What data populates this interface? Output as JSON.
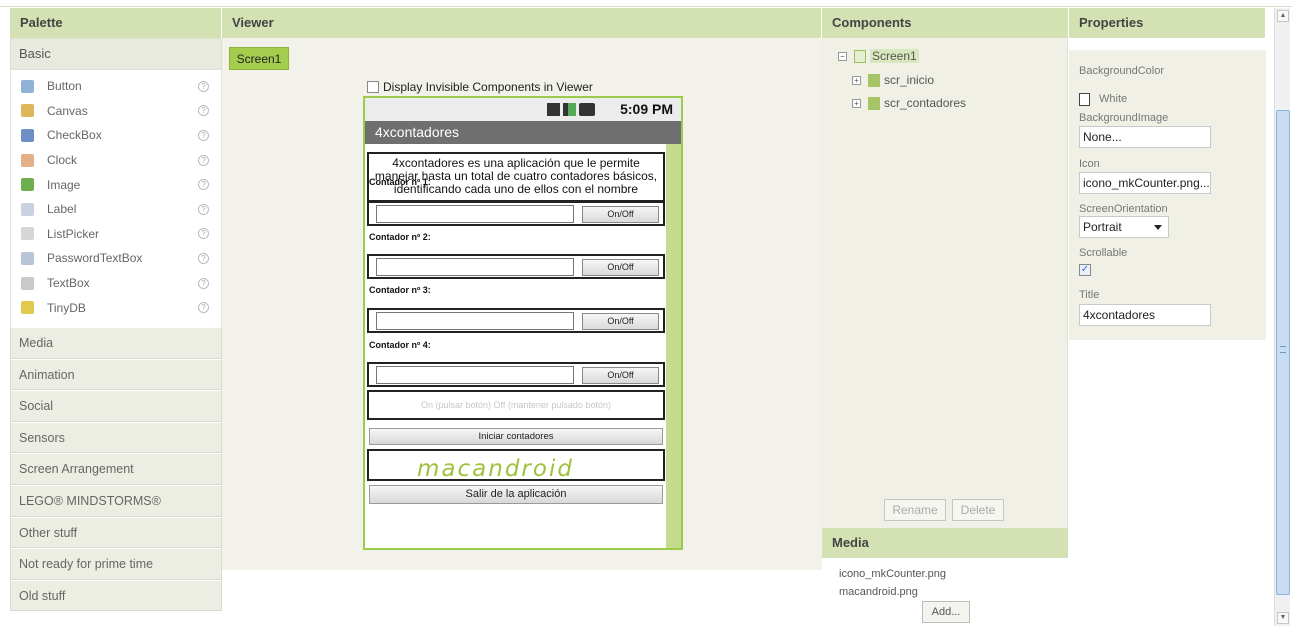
{
  "headers": {
    "palette": "Palette",
    "viewer": "Viewer",
    "components": "Components",
    "properties": "Properties",
    "media": "Media"
  },
  "palette": {
    "basic_label": "Basic",
    "items": [
      {
        "label": "Button",
        "icon": "button-icon",
        "color": "#8fb2d6"
      },
      {
        "label": "Canvas",
        "icon": "canvas-icon",
        "color": "#e0b65a"
      },
      {
        "label": "CheckBox",
        "icon": "checkbox-icon",
        "color": "#6d8fc4"
      },
      {
        "label": "Clock",
        "icon": "clock-icon",
        "color": "#e3b08a"
      },
      {
        "label": "Image",
        "icon": "image-icon",
        "color": "#6fae4f"
      },
      {
        "label": "Label",
        "icon": "label-icon",
        "color": "#c8d2e0"
      },
      {
        "label": "ListPicker",
        "icon": "listpicker-icon",
        "color": "#d6d6d6"
      },
      {
        "label": "PasswordTextBox",
        "icon": "password-icon",
        "color": "#b7c5d6"
      },
      {
        "label": "TextBox",
        "icon": "textbox-icon",
        "color": "#c9c9c9"
      },
      {
        "label": "TinyDB",
        "icon": "tinydb-icon",
        "color": "#e1c84f"
      }
    ],
    "help_glyph": "?",
    "categories": [
      "Media",
      "Animation",
      "Social",
      "Sensors",
      "Screen Arrangement",
      "LEGO® MINDSTORMS®",
      "Other stuff",
      "Not ready for prime time",
      "Old stuff"
    ]
  },
  "viewer": {
    "screen_tab": "Screen1",
    "display_invisible": "Display Invisible Components in Viewer",
    "status_time": "5:09 PM",
    "app_title": "4xcontadores",
    "intro_text": "4xcontadores es una aplicación que le permite manejar hasta un total de cuatro contadores básicos, identificando cada uno de ellos con el nombre",
    "counters": [
      "Contador nº 1:",
      "Contador nº 2:",
      "Contador nº 3:",
      "Contador nº 4:"
    ],
    "onoff_label": "On/Off",
    "hint": "On (pulsar botón) Off (mantener pulsado botón)",
    "start_button": "Iniciar contadores",
    "logo_text": "macandroid",
    "exit_button": "Salir de la aplicación"
  },
  "components": {
    "root": "Screen1",
    "children": [
      "scr_inicio",
      "scr_contadores"
    ],
    "rename": "Rename",
    "delete": "Delete"
  },
  "media": {
    "files": [
      "icono_mkCounter.png",
      "macandroid.png"
    ],
    "add": "Add..."
  },
  "properties": {
    "background_color_label": "BackgroundColor",
    "background_color_value": "White",
    "background_image_label": "BackgroundImage",
    "background_image_value": "None...",
    "icon_label": "Icon",
    "icon_value": "icono_mkCounter.png...",
    "orientation_label": "ScreenOrientation",
    "orientation_value": "Portrait",
    "scrollable_label": "Scrollable",
    "scrollable_checked": true,
    "title_label": "Title",
    "title_value": "4xcontadores"
  }
}
